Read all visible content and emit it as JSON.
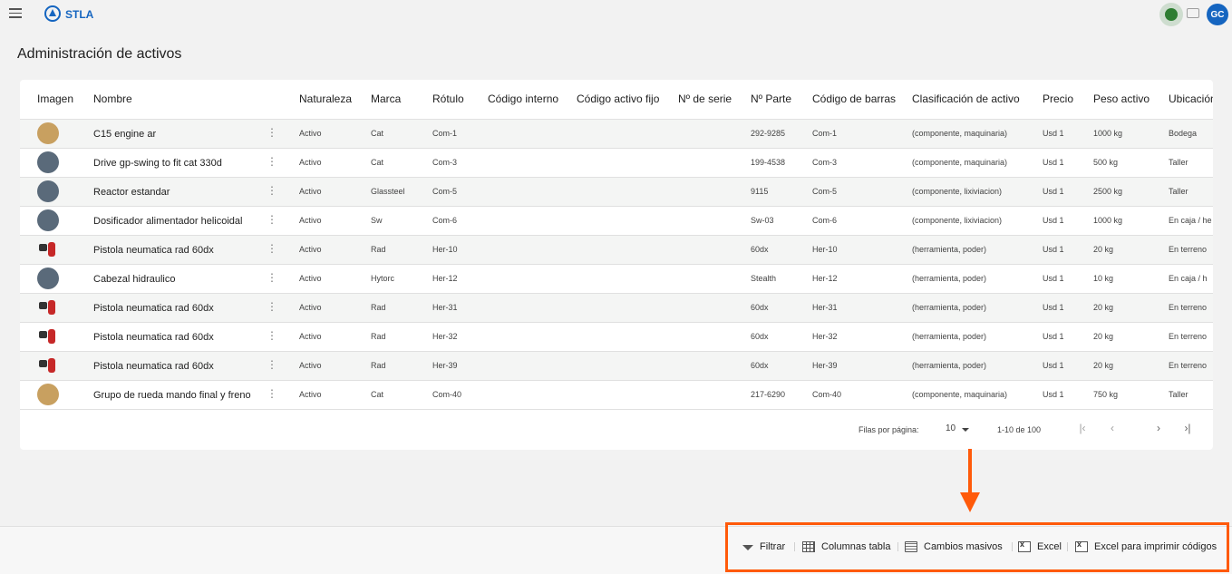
{
  "app": {
    "brand": "STLA",
    "user_initials": "GC"
  },
  "page": {
    "title": "Administración de activos"
  },
  "table": {
    "columns": [
      "Imagen",
      "Nombre",
      "Naturaleza",
      "Marca",
      "Rótulo",
      "Código interno",
      "Código activo fijo",
      "Nº de serie",
      "Nº Parte",
      "Código de barras",
      "Clasificación de activo",
      "Precio",
      "Peso activo",
      "Ubicación"
    ],
    "rows": [
      {
        "thumb": "engine-thumb",
        "nombre": "C15 engine ar",
        "naturaleza": "Activo",
        "marca": "Cat",
        "rotulo": "Com-1",
        "codigo_interno": "",
        "codigo_activo_fijo": "",
        "serie": "",
        "parte": "292-9285",
        "barras": "Com-1",
        "clasificacion": "(componente, maquinaria)",
        "precio": "Usd 1",
        "peso": "1000 kg",
        "ubicacion": "Bodega"
      },
      {
        "thumb": "drive-thumb",
        "nombre": "Drive gp-swing to fit cat 330d",
        "naturaleza": "Activo",
        "marca": "Cat",
        "rotulo": "Com-3",
        "codigo_interno": "",
        "codigo_activo_fijo": "",
        "serie": "",
        "parte": "199-4538",
        "barras": "Com-3",
        "clasificacion": "(componente, maquinaria)",
        "precio": "Usd 1",
        "peso": "500 kg",
        "ubicacion": "Taller"
      },
      {
        "thumb": "reactor-thumb",
        "nombre": "Reactor estandar",
        "naturaleza": "Activo",
        "marca": "Glassteel",
        "rotulo": "Com-5",
        "codigo_interno": "",
        "codigo_activo_fijo": "",
        "serie": "",
        "parte": "9115",
        "barras": "Com-5",
        "clasificacion": "(componente, lixiviacion)",
        "precio": "Usd 1",
        "peso": "2500 kg",
        "ubicacion": "Taller"
      },
      {
        "thumb": "dosificador-thumb",
        "nombre": "Dosificador alimentador helicoidal",
        "naturaleza": "Activo",
        "marca": "Sw",
        "rotulo": "Com-6",
        "codigo_interno": "",
        "codigo_activo_fijo": "",
        "serie": "",
        "parte": "Sw-03",
        "barras": "Com-6",
        "clasificacion": "(componente, lixiviacion)",
        "precio": "Usd 1",
        "peso": "1000 kg",
        "ubicacion": "En caja / he"
      },
      {
        "thumb": "pistola-thumb",
        "nombre": "Pistola neumatica rad 60dx",
        "naturaleza": "Activo",
        "marca": "Rad",
        "rotulo": "Her-10",
        "codigo_interno": "",
        "codigo_activo_fijo": "",
        "serie": "",
        "parte": "60dx",
        "barras": "Her-10",
        "clasificacion": "(herramienta, poder)",
        "precio": "Usd 1",
        "peso": "20 kg",
        "ubicacion": "En terreno"
      },
      {
        "thumb": "cabezal-thumb",
        "nombre": "Cabezal hidraulico",
        "naturaleza": "Activo",
        "marca": "Hytorc",
        "rotulo": "Her-12",
        "codigo_interno": "",
        "codigo_activo_fijo": "",
        "serie": "",
        "parte": "Stealth",
        "barras": "Her-12",
        "clasificacion": "(herramienta, poder)",
        "precio": "Usd 1",
        "peso": "10 kg",
        "ubicacion": "En caja / h"
      },
      {
        "thumb": "pistola-thumb",
        "nombre": "Pistola neumatica rad 60dx",
        "naturaleza": "Activo",
        "marca": "Rad",
        "rotulo": "Her-31",
        "codigo_interno": "",
        "codigo_activo_fijo": "",
        "serie": "",
        "parte": "60dx",
        "barras": "Her-31",
        "clasificacion": "(herramienta, poder)",
        "precio": "Usd 1",
        "peso": "20 kg",
        "ubicacion": "En terreno"
      },
      {
        "thumb": "pistola-thumb",
        "nombre": "Pistola neumatica rad 60dx",
        "naturaleza": "Activo",
        "marca": "Rad",
        "rotulo": "Her-32",
        "codigo_interno": "",
        "codigo_activo_fijo": "",
        "serie": "",
        "parte": "60dx",
        "barras": "Her-32",
        "clasificacion": "(herramienta, poder)",
        "precio": "Usd 1",
        "peso": "20 kg",
        "ubicacion": "En terreno"
      },
      {
        "thumb": "pistola-thumb",
        "nombre": "Pistola neumatica rad 60dx",
        "naturaleza": "Activo",
        "marca": "Rad",
        "rotulo": "Her-39",
        "codigo_interno": "",
        "codigo_activo_fijo": "",
        "serie": "",
        "parte": "60dx",
        "barras": "Her-39",
        "clasificacion": "(herramienta, poder)",
        "precio": "Usd 1",
        "peso": "20 kg",
        "ubicacion": "En terreno"
      },
      {
        "thumb": "rueda-thumb",
        "nombre": "Grupo de rueda mando final y freno",
        "naturaleza": "Activo",
        "marca": "Cat",
        "rotulo": "Com-40",
        "codigo_interno": "",
        "codigo_activo_fijo": "",
        "serie": "",
        "parte": "217-6290",
        "barras": "Com-40",
        "clasificacion": "(componente, maquinaria)",
        "precio": "Usd 1",
        "peso": "750 kg",
        "ubicacion": "Taller"
      }
    ]
  },
  "pagination": {
    "rows_per_page_label": "Filas por página:",
    "rows_per_page": "10",
    "range": "1-10 de 100"
  },
  "actions": {
    "filtrar": "Filtrar",
    "columnas": "Columnas tabla",
    "cambios": "Cambios masivos",
    "excel": "Excel",
    "excel_codigos": "Excel para imprimir códigos"
  },
  "colors": {
    "brand": "#1565c0",
    "status_online": "#2e7d32",
    "highlight": "#ff5a0a"
  }
}
